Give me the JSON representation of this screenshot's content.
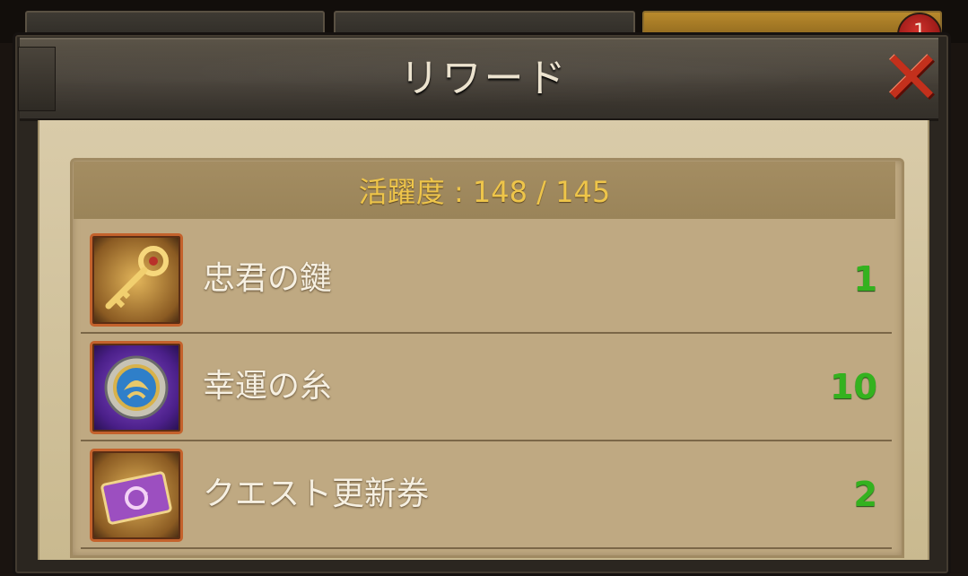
{
  "header": {
    "title": "リワード",
    "tab_badge": "1"
  },
  "activity": {
    "text": "活躍度 : 148 / 145"
  },
  "rewards": [
    {
      "name": "忠君の鍵",
      "quantity": "1",
      "icon": "golden-key-icon"
    },
    {
      "name": "幸運の糸",
      "quantity": "10",
      "icon": "lucky-thread-medallion-icon"
    },
    {
      "name": "クエスト更新券",
      "quantity": "2",
      "icon": "quest-refresh-ticket-icon"
    }
  ],
  "colors": {
    "accent_gold": "#eec54a",
    "quantity_green": "#34b21f",
    "close_red": "#c3301c"
  }
}
